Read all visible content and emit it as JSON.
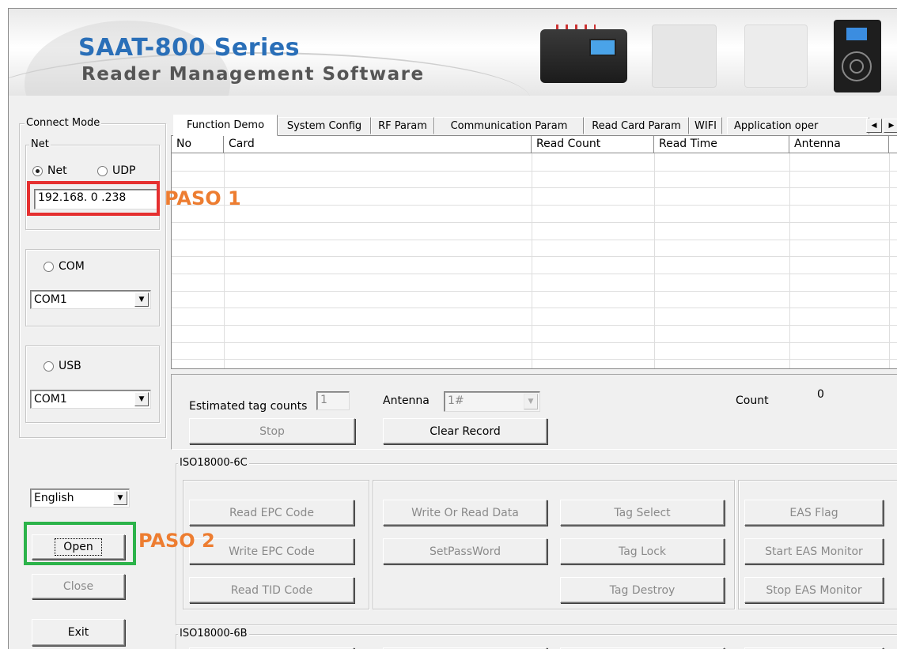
{
  "banner": {
    "title": "SAAT-800 Series",
    "subtitle": "Reader Management Software"
  },
  "connect": {
    "group_label": "Connect Mode",
    "net_group_label": "Net",
    "net_radio": "Net",
    "udp_radio": "UDP",
    "ip_value": "192.168.  0  .238",
    "com_radio": "COM",
    "com_value": "COM1",
    "usb_radio": "USB",
    "usb_value": "COM1"
  },
  "language": {
    "value": "English"
  },
  "buttons": {
    "open": "Open",
    "close": "Close",
    "exit": "Exit"
  },
  "tabs": [
    "Function Demo",
    "System Config",
    "RF Param",
    "Communication Param",
    "Read Card Param",
    "WIFI",
    "Application oper"
  ],
  "tab_scroll": {
    "left": "◀",
    "right": "▶"
  },
  "table": {
    "columns": [
      "No",
      "Card",
      "Read Count",
      "Read Time",
      "Antenna"
    ],
    "rows": []
  },
  "controls": {
    "estimated_label": "Estimated tag counts",
    "estimated_value": "1",
    "antenna_label": "Antenna",
    "antenna_value": "1#",
    "count_label": "Count",
    "count_value": "0",
    "stop": "Stop",
    "clear": "Clear Record"
  },
  "iso6c": {
    "label": "ISO18000-6C",
    "read_epc": "Read EPC Code",
    "write_epc": "Write EPC Code",
    "read_tid": "Read TID Code",
    "write_read_data": "Write Or Read Data",
    "set_password": "SetPassWord",
    "tag_select": "Tag Select",
    "tag_lock": "Tag Lock",
    "tag_destroy": "Tag Destroy",
    "eas_flag": "EAS Flag",
    "start_eas": "Start EAS Monitor",
    "stop_eas": "Stop EAS Monitor"
  },
  "iso6b": {
    "label": "ISO18000-6B"
  },
  "annotations": {
    "step1": "PASO 1",
    "step2": "PASO 2",
    "step1_color": "#e53030",
    "step2_color": "#2cb34a",
    "text_color": "#ed7d31"
  }
}
